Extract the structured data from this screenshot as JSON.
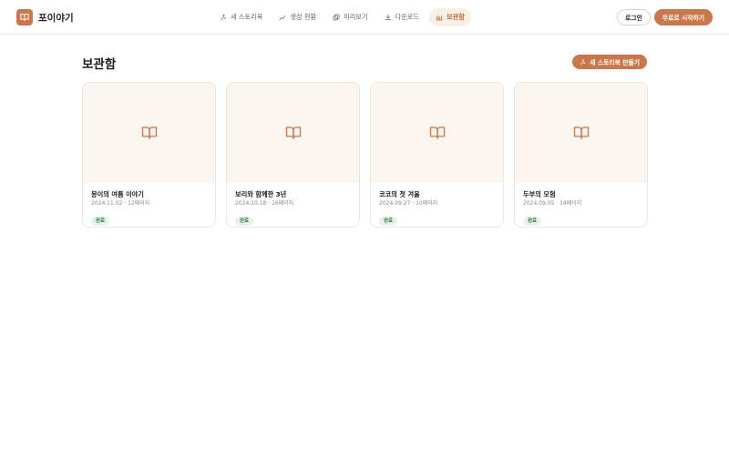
{
  "brand": {
    "name": "포이야기"
  },
  "nav": {
    "items": [
      {
        "label": "새 스토리북",
        "icon": "sparkle-icon"
      },
      {
        "label": "생성 현황",
        "icon": "trend-icon"
      },
      {
        "label": "미리보기",
        "icon": "layers-icon"
      },
      {
        "label": "다운로드",
        "icon": "download-icon"
      },
      {
        "label": "보관함",
        "icon": "archive-icon",
        "active": true
      }
    ]
  },
  "auth": {
    "login_label": "로그인",
    "start_label": "무료로 시작하기"
  },
  "page": {
    "title": "보관함",
    "new_button_label": "새 스토리북 만들기"
  },
  "colors": {
    "accent": "#c8784a",
    "cover": "#fbf5ef",
    "badge_bg": "#e6f3ea",
    "badge_text": "#2d7a45"
  },
  "books": [
    {
      "title": "몽이의 여름 이야기",
      "meta": "2024.11.02 · 12페이지",
      "status": "완료"
    },
    {
      "title": "보리와 함께한 3년",
      "meta": "2024.10.18 · 16페이지",
      "status": "완료"
    },
    {
      "title": "코코의 첫 겨울",
      "meta": "2024.09.27 · 10페이지",
      "status": "완료"
    },
    {
      "title": "두부의 모험",
      "meta": "2024.09.05 · 14페이지",
      "status": "완료"
    }
  ]
}
